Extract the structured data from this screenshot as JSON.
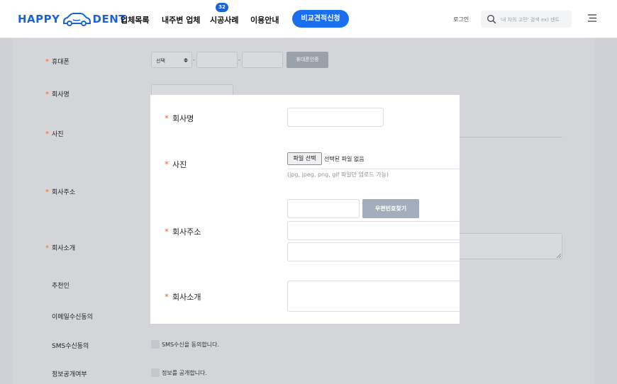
{
  "header": {
    "logo_left": "HAPPY",
    "logo_right": "DENT",
    "nav": [
      {
        "label": "업체목록"
      },
      {
        "label": "내주변 업체"
      },
      {
        "label": "시공사례",
        "badge": "32"
      },
      {
        "label": "이용안내"
      }
    ],
    "cta_label": "비교견적신청",
    "login_label": "로그인",
    "search_placeholder": "'내 차의 고민' 검색 ex) 덴트",
    "accent_color": "#1a6ff0"
  },
  "form": {
    "phone_label": "휴대폰",
    "phone_select_value": "선택",
    "phone_separator": "-",
    "phone_verify_button": "휴대폰인증",
    "company_name_label": "회사명",
    "photo_label": "사진",
    "address_label": "회사주소",
    "intro_label": "회사소개",
    "referrer_label": "추천인",
    "email_consent_label": "이메일수신동의",
    "sms_consent_label": "SMS수신동의",
    "sms_consent_text": "SMS수신을 동의합니다.",
    "info_public_label": "정보공개여부",
    "info_public_text": "정보를 공개합니다."
  },
  "modal": {
    "company_name_label": "회사명",
    "photo_label": "사진",
    "file_button": "파일 선택",
    "file_status": "선택된 파일 없음",
    "file_hint": "(jpg, jpeg, png, gif 파일만 업로드 가능)",
    "address_label": "회사주소",
    "zip_button": "우편번호찾기",
    "intro_label": "회사소개"
  },
  "required_mark": "*"
}
